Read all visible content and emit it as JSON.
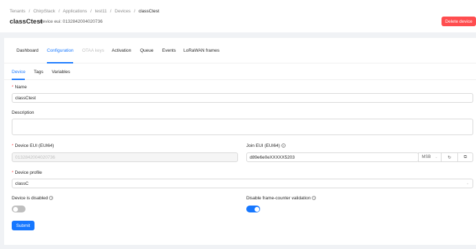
{
  "breadcrumb": [
    "Tenants",
    "/",
    "ChirpStack",
    "/",
    "Applications",
    "/",
    "test11",
    "/",
    "Devices",
    "/",
    "classCtest"
  ],
  "page": {
    "title": "classCtest",
    "subtitle": "device eui: 0132842004020736",
    "delete_label": "Delete device"
  },
  "tabs": [
    "Dashboard",
    "Configuration",
    "OTAA keys",
    "Activation",
    "Queue",
    "Events",
    "LoRaWAN frames"
  ],
  "subtabs": [
    "Device",
    "Tags",
    "Variables"
  ],
  "form": {
    "required_mark": "*",
    "name_label": "Name",
    "name_value": "classCtest",
    "description_label": "Description",
    "dev_eui_label": "Device EUI (EUI64)",
    "dev_eui_value": "0132842004020736",
    "join_eui_label": "Join EUI (EUI64)",
    "join_eui_value": "d89e6e0eXXXXX5203",
    "msb_label": "MSB",
    "device_profile_label": "Device profile",
    "device_profile_value": "classC",
    "device_disabled_label": "Device is disabled",
    "disable_fcnt_label": "Disable frame-counter validation",
    "device_disabled_on": false,
    "disable_fcnt_on": true,
    "info_glyph": "?",
    "submit_label": "Submit"
  },
  "colors": {
    "primary": "#1677ff",
    "danger": "#ff4d4f",
    "toggle_off": "#bfbfbf"
  }
}
